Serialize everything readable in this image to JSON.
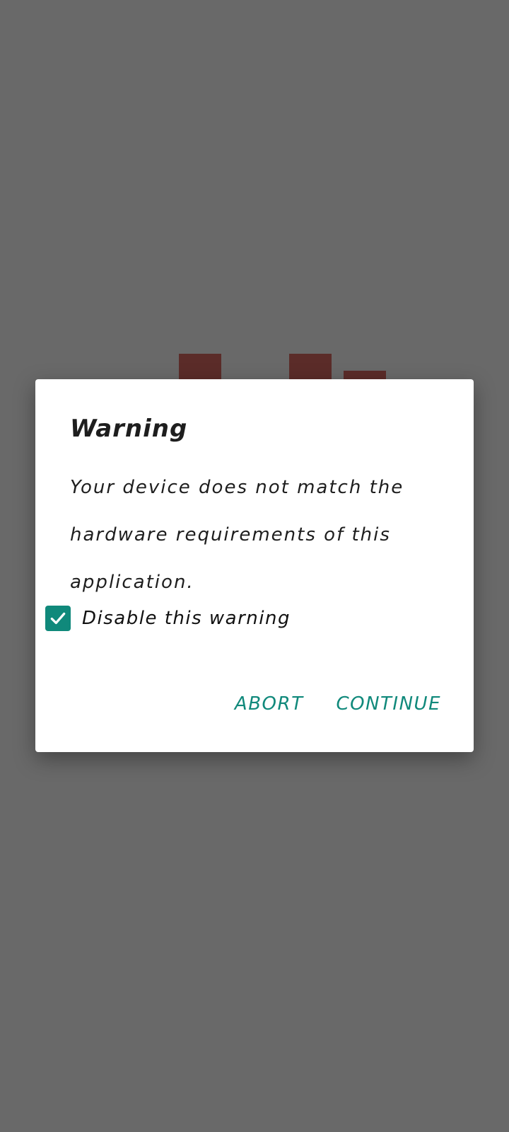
{
  "dialog": {
    "title": "Warning",
    "message": "Your device does not match the hardware requirements of this application.",
    "checkbox": {
      "label": "Disable this warning",
      "checked": true
    },
    "buttons": {
      "abort": "ABORT",
      "continue": "CONTINUE"
    }
  },
  "colors": {
    "accent": "#10897b",
    "background_logo": "#c6362e",
    "dialog_background": "#ffffff",
    "text": "#1e1e1e"
  },
  "icons": {
    "checkbox": "check-icon"
  }
}
